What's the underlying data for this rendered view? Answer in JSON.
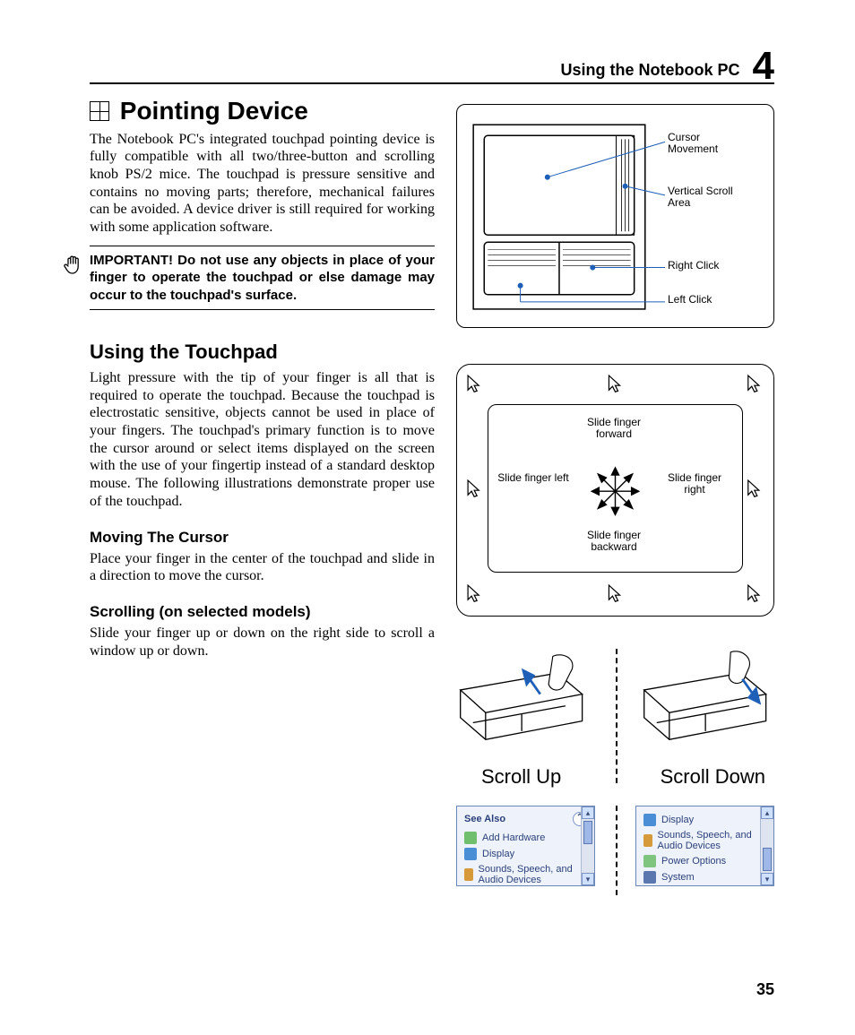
{
  "header": {
    "title": "Using the Notebook PC",
    "chapter": "4"
  },
  "page_number": "35",
  "section": {
    "title": "Pointing Device",
    "intro": "The Notebook PC's integrated touchpad pointing device is fully compatible with all two/three-button and scrolling knob PS/2 mice. The touchpad is pressure sensitive and contains no moving parts; therefore, mechanical failures can be avoided. A device driver is still required for working with some application software.",
    "important": "IMPORTANT! Do not use any objects in place of your finger to operate the touchpad or else damage may occur to the touchpad's surface."
  },
  "using": {
    "title": "Using the Touchpad",
    "intro": "Light pressure with the tip of your finger is all that is required to operate the touchpad. Because the touchpad is electrostatic sensitive, objects cannot be used in place of your fingers. The touchpad's primary function is to move the cursor around or select items displayed on the screen with the use of your fingertip instead of a standard desktop mouse. The following illustrations demonstrate proper use of the touchpad.",
    "moving_title": "Moving The Cursor",
    "moving_body": "Place your finger in the center of the touchpad and slide in a direction to move the cursor.",
    "scrolling_title": "Scrolling (on selected models)",
    "scrolling_body": "Slide your finger up or down on the right side to scroll a window up or down."
  },
  "fig1_labels": {
    "cursor": "Cursor Movement",
    "vscroll": "Vertical Scroll Area",
    "rclick": "Right Click",
    "lclick": "Left Click"
  },
  "fig2_labels": {
    "forward": "Slide finger forward",
    "backward": "Slide finger backward",
    "left": "Slide finger left",
    "right": "Slide finger right"
  },
  "fig3": {
    "up": "Scroll Up",
    "down": "Scroll Down",
    "seealso": "See Also",
    "items_left": [
      "Add Hardware",
      "Display",
      "Sounds, Speech, and Audio Devices"
    ],
    "items_right": [
      "Display",
      "Sounds, Speech, and Audio Devices",
      "Power Options",
      "System"
    ]
  }
}
